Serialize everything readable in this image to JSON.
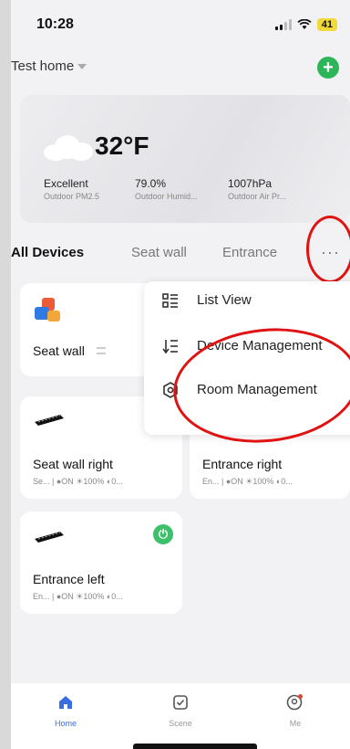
{
  "status_bar": {
    "time": "10:28",
    "battery": "41"
  },
  "header": {
    "home_title": "Test home"
  },
  "weather": {
    "temperature": "32°F",
    "metrics": [
      {
        "value": "Excellent",
        "label": "Outdoor PM2.5"
      },
      {
        "value": "79.0%",
        "label": "Outdoor Humid..."
      },
      {
        "value": "1007hPa",
        "label": "Outdoor Air Pr..."
      }
    ]
  },
  "tabs": [
    {
      "label": "All Devices",
      "active": true
    },
    {
      "label": "Seat wall",
      "active": false
    },
    {
      "label": "Entrance",
      "active": false
    }
  ],
  "more_label": "···",
  "devices": [
    {
      "name": "Seat wall",
      "status": ""
    },
    {
      "name": "Seat wall right",
      "status": "Se... | ●ON ☀100% ◐0..."
    },
    {
      "name": "Entrance right",
      "status": "En... | ●ON ☀100% ◐0..."
    },
    {
      "name": "Entrance left",
      "status": "En... | ●ON ☀100% ◐0..."
    }
  ],
  "menu": {
    "items": [
      {
        "label": "List View",
        "icon": "list-view-icon"
      },
      {
        "label": "Device Management",
        "icon": "sort-list-icon"
      },
      {
        "label": "Room Management",
        "icon": "hexagon-settings-icon"
      }
    ]
  },
  "tabbar": {
    "items": [
      {
        "label": "Home",
        "icon": "home-icon",
        "active": true
      },
      {
        "label": "Scene",
        "icon": "check-square-icon",
        "active": false
      },
      {
        "label": "Me",
        "icon": "user-icon",
        "active": false
      }
    ]
  },
  "colors": {
    "accent_green": "#3cc06a",
    "active_blue": "#3a6ee0",
    "annotation_red": "#e01212"
  }
}
